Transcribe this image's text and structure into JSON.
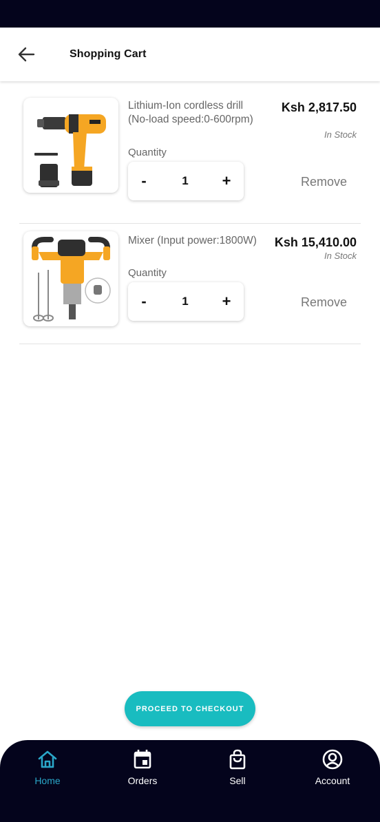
{
  "header": {
    "title": "Shopping Cart"
  },
  "cart": {
    "items": [
      {
        "name": "Lithium-Ion cordless drill (No-load speed:0-600rpm)",
        "price": "Ksh 2,817.50",
        "stock": "In Stock",
        "quantity_label": "Quantity",
        "quantity": "1",
        "minus_label": "-",
        "plus_label": "+",
        "remove_label": "Remove"
      },
      {
        "name": "Mixer (Input power:1800W)",
        "price": "Ksh 15,410.00",
        "stock": "In Stock",
        "quantity_label": "Quantity",
        "quantity": "1",
        "minus_label": "-",
        "plus_label": "+",
        "remove_label": "Remove"
      }
    ],
    "checkout_label": "PROCEED TO CHECKOUT"
  },
  "bottom_nav": {
    "items": [
      {
        "label": "Home",
        "icon": "home-icon",
        "active": true
      },
      {
        "label": "Orders",
        "icon": "calendar-icon",
        "active": false
      },
      {
        "label": "Sell",
        "icon": "shopping-bag-icon",
        "active": false
      },
      {
        "label": "Account",
        "icon": "account-circle-icon",
        "active": false
      }
    ]
  },
  "colors": {
    "accent": "#19bcc0",
    "nav_background": "#04041c",
    "nav_active": "#2aa7c9",
    "product_yellow": "#f5a623"
  }
}
